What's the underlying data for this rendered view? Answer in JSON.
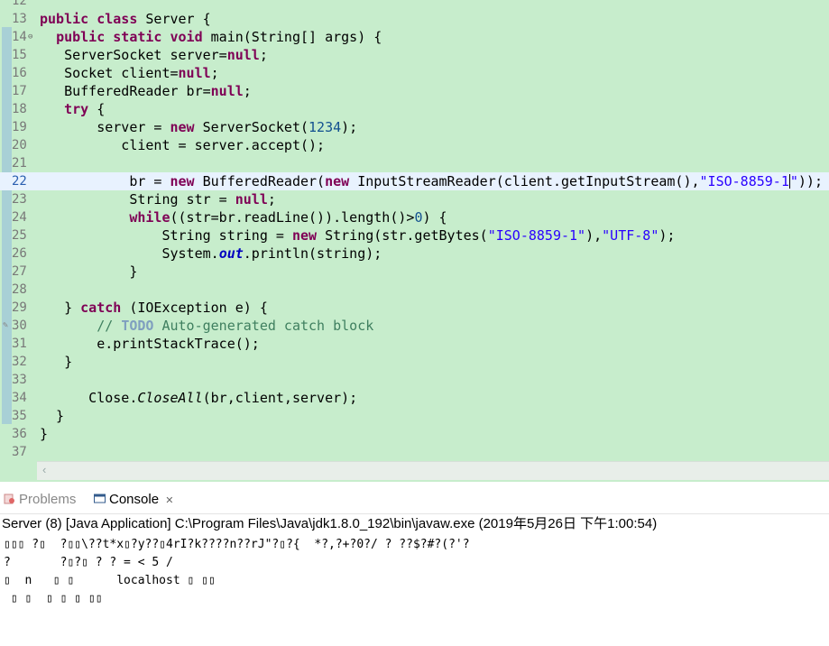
{
  "editor": {
    "lines": [
      {
        "n": "12",
        "code": ""
      },
      {
        "n": "13",
        "code": "<span class='kw'>public class</span> Server {"
      },
      {
        "n": "14",
        "code": "  <span class='kw'>public static void</span> main(String[] args) {"
      },
      {
        "n": "15",
        "code": "   ServerSocket server=<span class='kw'>null</span>;"
      },
      {
        "n": "16",
        "code": "   Socket client=<span class='kw'>null</span>;"
      },
      {
        "n": "17",
        "code": "   BufferedReader br=<span class='kw'>null</span>;"
      },
      {
        "n": "18",
        "code": "   <span class='kw'>try</span> {"
      },
      {
        "n": "19",
        "code": "       server = <span class='kw'>new</span> ServerSocket(<span class='num'>1234</span>);"
      },
      {
        "n": "20",
        "code": "          client = server.accept();"
      },
      {
        "n": "21",
        "code": ""
      },
      {
        "n": "22",
        "code": "           br = <span class='kw'>new</span> BufferedReader(<span class='kw'>new</span> InputStreamReader(client.getInputStream(),<span class='str'>\"ISO-8859-1</span><span class='caret'></span><span class='str'>\"</span>));"
      },
      {
        "n": "23",
        "code": "           String str = <span class='kw'>null</span>;"
      },
      {
        "n": "24",
        "code": "           <span class='kw'>while</span>((str=br.readLine()).length()&gt;<span class='num'>0</span>) {"
      },
      {
        "n": "25",
        "code": "               String string = <span class='kw'>new</span> String(str.getBytes(<span class='str'>\"ISO-8859-1\"</span>),<span class='str'>\"UTF-8\"</span>);"
      },
      {
        "n": "26",
        "code": "               System.<span class='fld'>out</span>.println(string);"
      },
      {
        "n": "27",
        "code": "           }"
      },
      {
        "n": "28",
        "code": ""
      },
      {
        "n": "29",
        "code": "   } <span class='kw'>catch</span> (IOException e) {"
      },
      {
        "n": "30",
        "code": "       <span class='cm'>// </span><span class='todo'>TODO</span><span class='cm'> Auto-generated catch block</span>"
      },
      {
        "n": "31",
        "code": "       e.printStackTrace();"
      },
      {
        "n": "32",
        "code": "   }"
      },
      {
        "n": "33",
        "code": ""
      },
      {
        "n": "34",
        "code": "      Close.<span class='mth'>CloseAll</span>(br,client,server);"
      },
      {
        "n": "35",
        "code": "  }"
      },
      {
        "n": "36",
        "code": "}"
      },
      {
        "n": "37",
        "code": ""
      }
    ],
    "current_line": "22"
  },
  "panel": {
    "tabs": [
      {
        "label": "Problems",
        "active": false
      },
      {
        "label": "Console",
        "active": true
      }
    ],
    "close_glyph": "✕",
    "console_info": "Server (8) [Java Application] C:\\Program Files\\Java\\jdk1.8.0_192\\bin\\javaw.exe (2019年5月26日 下午1:00:54)",
    "output": [
      "▯▯▯ ?▯  ?▯▯\\??t*x▯?y??▯4rI?k????n??rJ\"?▯?{  *?,?+?0?/ ? ??$?#?(?'?",
      "?       ?▯?▯ ? ? = < 5 /",
      "▯  n   ▯ ▯      localhost ▯ ▯▯",
      " ▯ ▯  ▯ ▯ ▯ ▯▯"
    ]
  },
  "colors": {
    "editor_bg": "#c7edcc",
    "current_line_bg": "#e8f2fe",
    "keyword": "#7f0055",
    "string": "#2a00ff"
  }
}
